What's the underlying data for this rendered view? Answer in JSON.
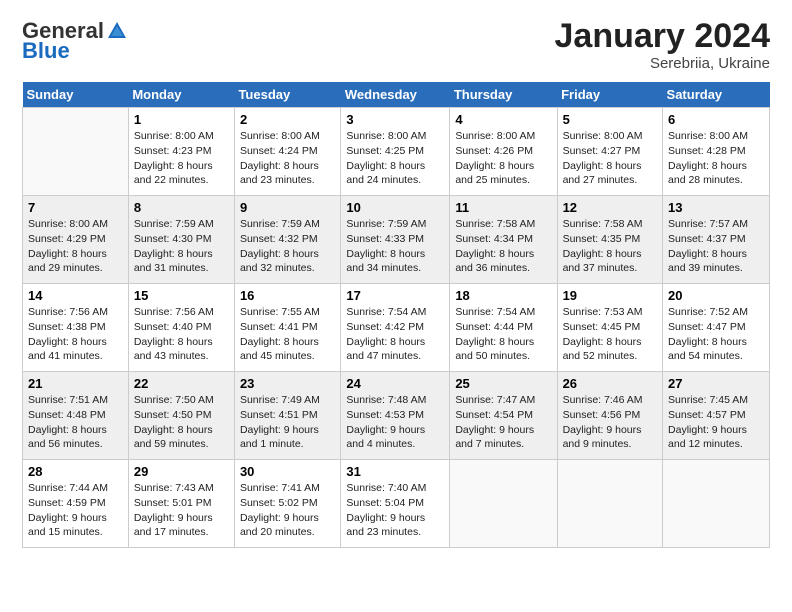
{
  "logo": {
    "general": "General",
    "blue": "Blue"
  },
  "title": "January 2024",
  "location": "Serebriia, Ukraine",
  "days_of_week": [
    "Sunday",
    "Monday",
    "Tuesday",
    "Wednesday",
    "Thursday",
    "Friday",
    "Saturday"
  ],
  "weeks": [
    [
      {
        "day": "",
        "info": ""
      },
      {
        "day": "1",
        "info": "Sunrise: 8:00 AM\nSunset: 4:23 PM\nDaylight: 8 hours\nand 22 minutes."
      },
      {
        "day": "2",
        "info": "Sunrise: 8:00 AM\nSunset: 4:24 PM\nDaylight: 8 hours\nand 23 minutes."
      },
      {
        "day": "3",
        "info": "Sunrise: 8:00 AM\nSunset: 4:25 PM\nDaylight: 8 hours\nand 24 minutes."
      },
      {
        "day": "4",
        "info": "Sunrise: 8:00 AM\nSunset: 4:26 PM\nDaylight: 8 hours\nand 25 minutes."
      },
      {
        "day": "5",
        "info": "Sunrise: 8:00 AM\nSunset: 4:27 PM\nDaylight: 8 hours\nand 27 minutes."
      },
      {
        "day": "6",
        "info": "Sunrise: 8:00 AM\nSunset: 4:28 PM\nDaylight: 8 hours\nand 28 minutes."
      }
    ],
    [
      {
        "day": "7",
        "info": "Sunrise: 8:00 AM\nSunset: 4:29 PM\nDaylight: 8 hours\nand 29 minutes."
      },
      {
        "day": "8",
        "info": "Sunrise: 7:59 AM\nSunset: 4:30 PM\nDaylight: 8 hours\nand 31 minutes."
      },
      {
        "day": "9",
        "info": "Sunrise: 7:59 AM\nSunset: 4:32 PM\nDaylight: 8 hours\nand 32 minutes."
      },
      {
        "day": "10",
        "info": "Sunrise: 7:59 AM\nSunset: 4:33 PM\nDaylight: 8 hours\nand 34 minutes."
      },
      {
        "day": "11",
        "info": "Sunrise: 7:58 AM\nSunset: 4:34 PM\nDaylight: 8 hours\nand 36 minutes."
      },
      {
        "day": "12",
        "info": "Sunrise: 7:58 AM\nSunset: 4:35 PM\nDaylight: 8 hours\nand 37 minutes."
      },
      {
        "day": "13",
        "info": "Sunrise: 7:57 AM\nSunset: 4:37 PM\nDaylight: 8 hours\nand 39 minutes."
      }
    ],
    [
      {
        "day": "14",
        "info": "Sunrise: 7:56 AM\nSunset: 4:38 PM\nDaylight: 8 hours\nand 41 minutes."
      },
      {
        "day": "15",
        "info": "Sunrise: 7:56 AM\nSunset: 4:40 PM\nDaylight: 8 hours\nand 43 minutes."
      },
      {
        "day": "16",
        "info": "Sunrise: 7:55 AM\nSunset: 4:41 PM\nDaylight: 8 hours\nand 45 minutes."
      },
      {
        "day": "17",
        "info": "Sunrise: 7:54 AM\nSunset: 4:42 PM\nDaylight: 8 hours\nand 47 minutes."
      },
      {
        "day": "18",
        "info": "Sunrise: 7:54 AM\nSunset: 4:44 PM\nDaylight: 8 hours\nand 50 minutes."
      },
      {
        "day": "19",
        "info": "Sunrise: 7:53 AM\nSunset: 4:45 PM\nDaylight: 8 hours\nand 52 minutes."
      },
      {
        "day": "20",
        "info": "Sunrise: 7:52 AM\nSunset: 4:47 PM\nDaylight: 8 hours\nand 54 minutes."
      }
    ],
    [
      {
        "day": "21",
        "info": "Sunrise: 7:51 AM\nSunset: 4:48 PM\nDaylight: 8 hours\nand 56 minutes."
      },
      {
        "day": "22",
        "info": "Sunrise: 7:50 AM\nSunset: 4:50 PM\nDaylight: 8 hours\nand 59 minutes."
      },
      {
        "day": "23",
        "info": "Sunrise: 7:49 AM\nSunset: 4:51 PM\nDaylight: 9 hours\nand 1 minute."
      },
      {
        "day": "24",
        "info": "Sunrise: 7:48 AM\nSunset: 4:53 PM\nDaylight: 9 hours\nand 4 minutes."
      },
      {
        "day": "25",
        "info": "Sunrise: 7:47 AM\nSunset: 4:54 PM\nDaylight: 9 hours\nand 7 minutes."
      },
      {
        "day": "26",
        "info": "Sunrise: 7:46 AM\nSunset: 4:56 PM\nDaylight: 9 hours\nand 9 minutes."
      },
      {
        "day": "27",
        "info": "Sunrise: 7:45 AM\nSunset: 4:57 PM\nDaylight: 9 hours\nand 12 minutes."
      }
    ],
    [
      {
        "day": "28",
        "info": "Sunrise: 7:44 AM\nSunset: 4:59 PM\nDaylight: 9 hours\nand 15 minutes."
      },
      {
        "day": "29",
        "info": "Sunrise: 7:43 AM\nSunset: 5:01 PM\nDaylight: 9 hours\nand 17 minutes."
      },
      {
        "day": "30",
        "info": "Sunrise: 7:41 AM\nSunset: 5:02 PM\nDaylight: 9 hours\nand 20 minutes."
      },
      {
        "day": "31",
        "info": "Sunrise: 7:40 AM\nSunset: 5:04 PM\nDaylight: 9 hours\nand 23 minutes."
      },
      {
        "day": "",
        "info": ""
      },
      {
        "day": "",
        "info": ""
      },
      {
        "day": "",
        "info": ""
      }
    ]
  ]
}
